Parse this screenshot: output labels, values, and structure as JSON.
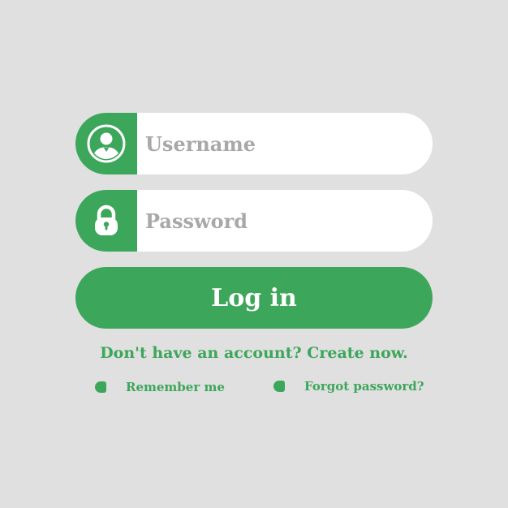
{
  "colors": {
    "background": "#e0e0e0",
    "accent": "#3ca65a",
    "field_background": "#ffffff",
    "placeholder_text": "#a8a8a8"
  },
  "form": {
    "username": {
      "icon": "user-icon",
      "placeholder": "Username",
      "value": ""
    },
    "password": {
      "icon": "lock-icon",
      "placeholder": "Password",
      "value": ""
    },
    "login_label": "Log in",
    "signup_text": "Don't have an account? Create now.",
    "remember_label": "Remember me",
    "forgot_label": "Forgot password?"
  }
}
